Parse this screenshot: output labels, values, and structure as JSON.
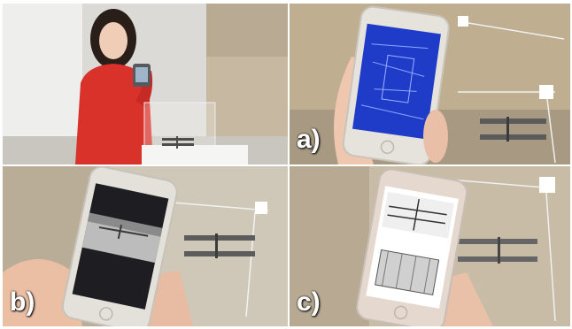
{
  "panels": {
    "top_left": {
      "label": ""
    },
    "top_right": {
      "label": "a)"
    },
    "bottom_left": {
      "label": "b)"
    },
    "bottom_right": {
      "label": "c)"
    }
  },
  "colors": {
    "sweater": "#d8322a",
    "phone_frame": "#e6e2dc",
    "blueprint": "#1f3cc9",
    "wall": "#c7b9a4",
    "background_top_left": "#d9d7d2"
  }
}
